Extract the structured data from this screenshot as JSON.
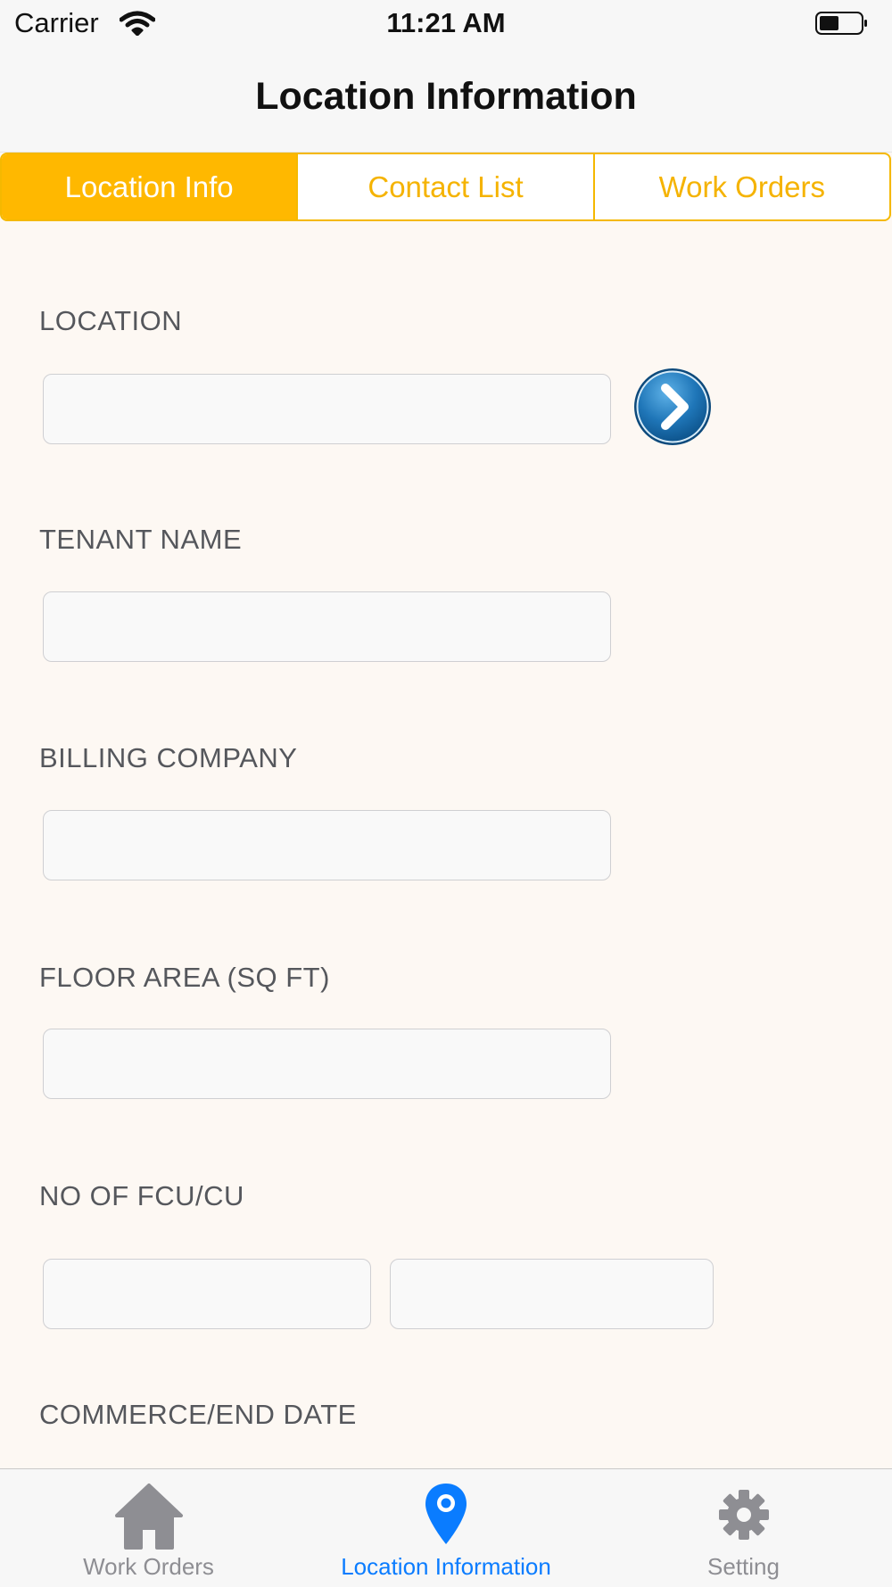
{
  "status_bar": {
    "carrier": "Carrier",
    "time": "11:21 AM"
  },
  "nav": {
    "title": "Location Information"
  },
  "segments": [
    {
      "label": "Location Info",
      "selected": true
    },
    {
      "label": "Contact List",
      "selected": false
    },
    {
      "label": "Work Orders",
      "selected": false
    }
  ],
  "form": {
    "location_label": "LOCATION",
    "location_value": "",
    "tenant_label": "TENANT NAME",
    "tenant_value": "",
    "billing_label": "BILLING COMPANY",
    "billing_value": "",
    "floor_area_label": "FLOOR AREA (SQ FT)",
    "floor_area_value": "",
    "fcu_cu_label": "NO OF FCU/CU",
    "fcu_value": "",
    "cu_value": "",
    "commerce_end_label": "COMMERCE/END DATE"
  },
  "tab_bar": {
    "items": [
      {
        "label": "Work Orders",
        "icon": "house-icon",
        "active": false
      },
      {
        "label": "Location Information",
        "icon": "map-pin-icon",
        "active": true
      },
      {
        "label": "Setting",
        "icon": "gear-icon",
        "active": false
      }
    ]
  },
  "colors": {
    "accent": "#ffb800",
    "tab_active": "#0a7cff",
    "tab_inactive": "#8e8e93",
    "go_button": "#1a6aa8",
    "background": "#fdf8f3"
  }
}
